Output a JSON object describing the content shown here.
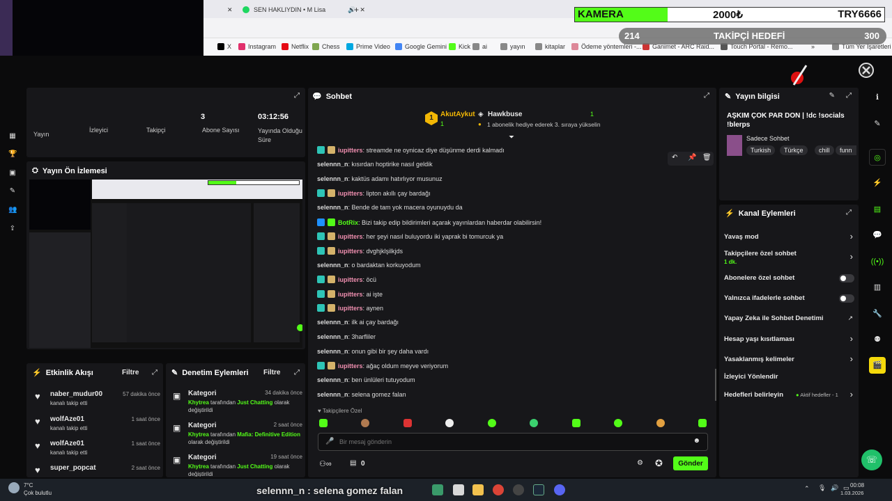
{
  "browser": {
    "tab_title": "SEN HAKLIYDIN • M Lisa",
    "bookmarks": [
      "X",
      "Instagram",
      "Netflix",
      "Chess",
      "Prime Video",
      "Google Gemini",
      "Kick",
      "ai",
      "yayın",
      "kitaplar",
      "Ödeme yöntemleri -...",
      "Ganimet - ARC Raid...",
      "Touch Portal - Remo...",
      "Tüm Yer İşaretleri"
    ]
  },
  "overlay": {
    "kamera_label": "KAMERA",
    "kamera_amount": "2000₺",
    "kamera_currency": "TRY6666",
    "kamera_progress": 0.3,
    "follow_current": "214",
    "follow_label": "TAKİPÇİ HEDEFİ",
    "follow_target": "300"
  },
  "stats": {
    "labels": [
      "Yayın",
      "İzleyici",
      "Takipçi",
      "Abone Sayısı",
      "Yayında Olduğu Süre"
    ],
    "value_partial": "3",
    "duration": "03:12:56"
  },
  "preview": {
    "title": "Yayın Ön İzlemesi"
  },
  "activity": {
    "title": "Etkinlik Akışı",
    "filter": "Filtre",
    "items": [
      {
        "user": "naber_mudur00",
        "action": "kanalı takip etti",
        "time": "57 dakika önce"
      },
      {
        "user": "wolfAze01",
        "action": "kanalı takip etti",
        "time": "1 saat önce"
      },
      {
        "user": "wolfAze01",
        "action": "kanalı takip etti",
        "time": "1 saat önce"
      },
      {
        "user": "super_popcat",
        "action": "",
        "time": "2 saat önce"
      }
    ]
  },
  "moderation": {
    "title": "Denetim Eylemleri",
    "filter": "Filtre",
    "items": [
      {
        "kind": "Kategori",
        "time": "34 dakika önce",
        "who": "Khytrea",
        "mid": " tarafından ",
        "cat": "Just Chatting",
        "tail": " olarak değiştirildi"
      },
      {
        "kind": "Kategori",
        "time": "2 saat önce",
        "who": "Khytrea",
        "mid": " tarafından ",
        "cat": "Mafia: Definitive Edition",
        "tail": " olarak değiştirildi"
      },
      {
        "kind": "Kategori",
        "time": "19 saat önce",
        "who": "Khytrea",
        "mid": " tarafından ",
        "cat": "Just Chatting",
        "tail": " olarak değiştirildi"
      }
    ]
  },
  "chat": {
    "title": "Sohbet",
    "top_gifters": [
      {
        "rank": "1",
        "name": "AkutAykut",
        "count": "1"
      },
      {
        "name": "Hawkbuse",
        "count": "1",
        "note": "1 abonelik hediye ederek 3. sıraya yükselin"
      }
    ],
    "messages": [
      {
        "user": "iupitters",
        "text": ": streamde ne oynicaz diye düşünme derdi kalmadı",
        "badge": true,
        "color": "pink"
      },
      {
        "user": "selennn_n",
        "text": ": kısırdan hoptirike nasıl geldik",
        "badge": false,
        "color": "plain"
      },
      {
        "user": "selennn_n",
        "text": ": kaktüs adamı hatırlıyor musunuz",
        "badge": false,
        "color": "plain"
      },
      {
        "user": "iupitters",
        "text": ": lipton akıllı çay bardağı",
        "badge": true,
        "color": "pink"
      },
      {
        "user": "selennn_n",
        "text": ": Bende de tam yok macera oyunuydu da",
        "badge": false,
        "color": "plain"
      },
      {
        "user": "BotRix",
        "text": ": Bizi takip edip bildirimleri açarak yayınlardan haberdar olabilirsin!",
        "badge": true,
        "color": "green"
      },
      {
        "user": "iupitters",
        "text": ": her şeyi nasıl buluyordu iki yaprak bi tomurcuk ya",
        "badge": true,
        "color": "pink"
      },
      {
        "user": "iupitters",
        "text": ": dvghjklşilkjds",
        "badge": true,
        "color": "pink"
      },
      {
        "user": "selennn_n",
        "text": ": o bardaktan korkuyodum",
        "badge": false,
        "color": "plain"
      },
      {
        "user": "iupitters",
        "text": ": öcü",
        "badge": true,
        "color": "pink"
      },
      {
        "user": "iupitters",
        "text": ": ai işte",
        "badge": true,
        "color": "pink"
      },
      {
        "user": "iupitters",
        "text": ": aynen",
        "badge": true,
        "color": "pink"
      },
      {
        "user": "selennn_n",
        "text": ": ilk ai çay bardağı",
        "badge": false,
        "color": "plain"
      },
      {
        "user": "selennn_n",
        "text": ": 3harfliler",
        "badge": false,
        "color": "plain"
      },
      {
        "user": "selennn_n",
        "text": ": onun gibi bir şey daha vardı",
        "badge": false,
        "color": "plain"
      },
      {
        "user": "iupitters",
        "text": ": ağaç oldum meyve veriyorum",
        "badge": true,
        "color": "pink"
      },
      {
        "user": "selennn_n",
        "text": ": ben ünlüleri tutuyodum",
        "badge": false,
        "color": "plain"
      },
      {
        "user": "selennn_n",
        "text": ": selena gomez falan",
        "badge": false,
        "color": "plain"
      }
    ],
    "followers_only": "Takipçilere Özel",
    "input_placeholder": "Bir mesaj gönderin",
    "count": "0",
    "send": "Gönder"
  },
  "stream_info": {
    "title": "Yayın bilgisi",
    "stream_title": "AŞKIM ÇOK PAR DON | !dc !socials !blerps",
    "category": "Sadece Sohbet",
    "tags": [
      "Turkish",
      "Türkçe",
      "chill",
      "funn"
    ]
  },
  "channel_actions": {
    "title": "Kanal Eylemleri",
    "items": [
      {
        "label": "Yavaş mod",
        "type": "arrow"
      },
      {
        "label": "Takipçilere özel sohbet",
        "sub": "1 dk.",
        "type": "arrow"
      },
      {
        "label": "Abonelere özel sohbet",
        "type": "toggle"
      },
      {
        "label": "Yalnızca ifadelerle sohbet",
        "type": "toggle"
      },
      {
        "label": "Yapay Zeka ile Sohbet Denetimi",
        "type": "ext"
      },
      {
        "label": "Hesap yaşı kısıtlaması",
        "type": "arrow"
      },
      {
        "label": "Yasaklanmış kelimeler",
        "type": "arrow"
      },
      {
        "label": "İzleyici Yönlendir",
        "type": "none"
      },
      {
        "label": "Hedefleri belirleyin",
        "type": "arrow",
        "extra": "Aktif hedefler - 1"
      }
    ]
  },
  "taskbar": {
    "temp": "7°C",
    "weather": "Çok bulutlu",
    "caption": "selennn_n : selena gomez falan",
    "time": "00:08",
    "date": "1.03.2026"
  }
}
